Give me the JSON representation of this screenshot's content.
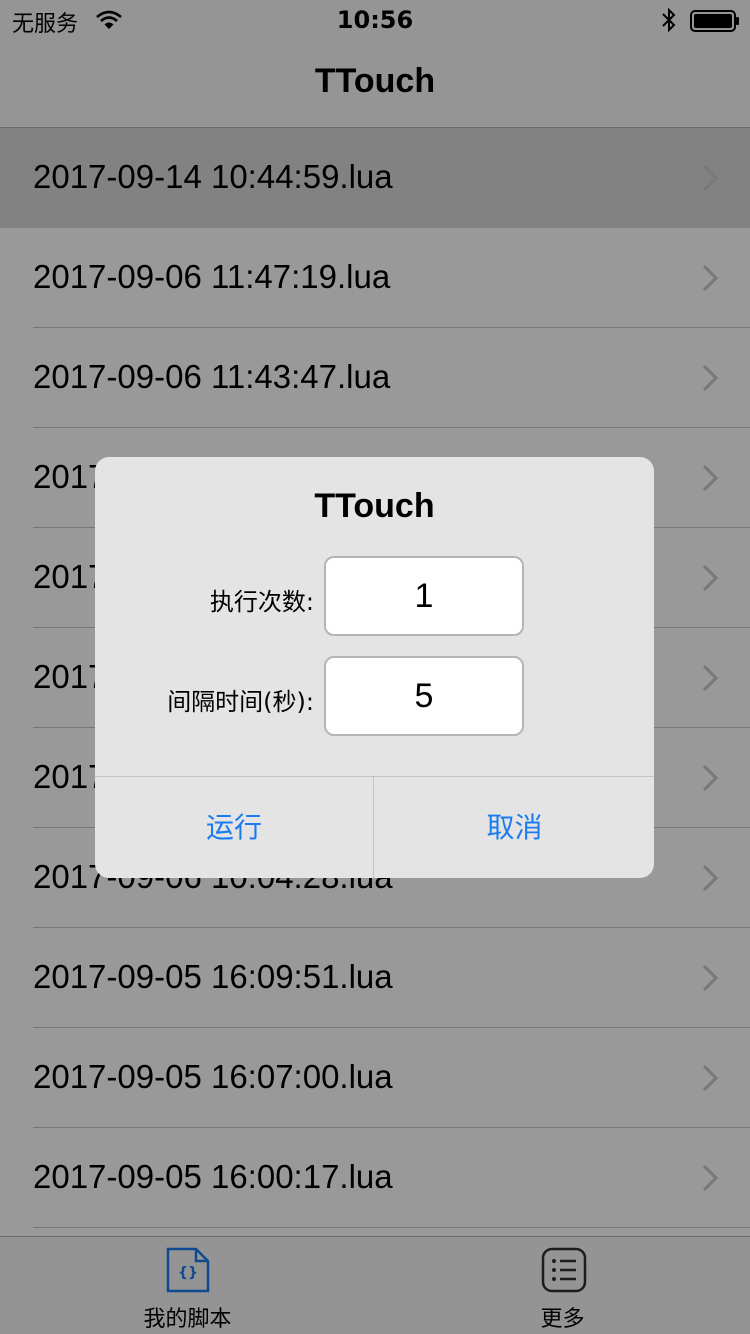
{
  "status_bar": {
    "carrier": "无服务",
    "time": "10:56"
  },
  "nav": {
    "title": "TTouch"
  },
  "scripts": [
    {
      "name": "2017-09-14 10:44:59.lua",
      "selected": true
    },
    {
      "name": "2017-09-06 11:47:19.lua",
      "selected": false
    },
    {
      "name": "2017-09-06 11:43:47.lua",
      "selected": false
    },
    {
      "name": "2017-",
      "selected": false
    },
    {
      "name": "2017-",
      "selected": false
    },
    {
      "name": "2017-",
      "selected": false
    },
    {
      "name": "2017-",
      "selected": false
    },
    {
      "name": "2017-09-06 10:04:28.lua",
      "selected": false
    },
    {
      "name": "2017-09-05 16:09:51.lua",
      "selected": false
    },
    {
      "name": "2017-09-05 16:07:00.lua",
      "selected": false
    },
    {
      "name": "2017-09-05 16:00:17.lua",
      "selected": false
    }
  ],
  "alert": {
    "title": "TTouch",
    "fields": [
      {
        "label": "执行次数:",
        "value": "1"
      },
      {
        "label": "间隔时间(秒):",
        "value": "5"
      }
    ],
    "run_label": "运行",
    "cancel_label": "取消"
  },
  "tabs": [
    {
      "label": "我的脚本",
      "icon": "script-file-icon",
      "active": true,
      "color": "#1a7cf0"
    },
    {
      "label": "更多",
      "icon": "list-icon",
      "active": false,
      "color": "#333333"
    }
  ]
}
